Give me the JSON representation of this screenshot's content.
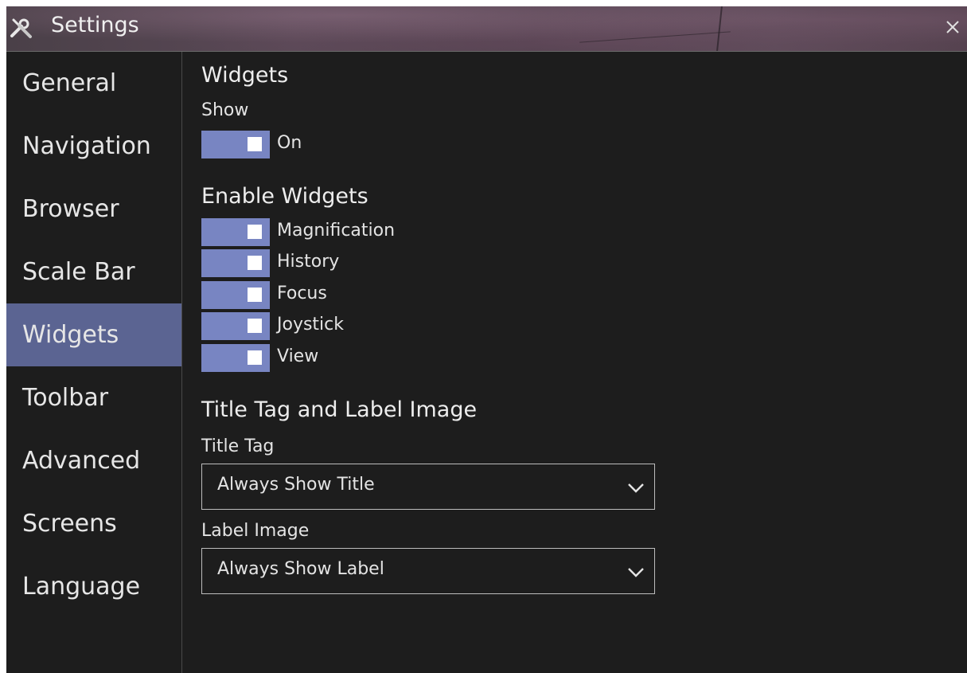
{
  "window": {
    "title": "Settings",
    "title_icon": "tools-icon",
    "close_icon": "close-icon"
  },
  "sidebar": {
    "items": [
      {
        "label": "General"
      },
      {
        "label": "Navigation"
      },
      {
        "label": "Browser"
      },
      {
        "label": "Scale Bar"
      },
      {
        "label": "Widgets",
        "active": true
      },
      {
        "label": "Toolbar"
      },
      {
        "label": "Advanced"
      },
      {
        "label": "Screens"
      },
      {
        "label": "Language"
      }
    ]
  },
  "main": {
    "widgets_heading": "Widgets",
    "show_label": "Show",
    "show_toggle": {
      "label": "On",
      "checked": true
    },
    "enable_heading": "Enable Widgets",
    "enable_toggles": [
      {
        "label": "Magnification",
        "checked": true
      },
      {
        "label": "History",
        "checked": true
      },
      {
        "label": "Focus",
        "checked": true
      },
      {
        "label": "Joystick",
        "checked": true
      },
      {
        "label": "View",
        "checked": true
      }
    ],
    "title_label_heading": "Title Tag and Label Image",
    "title_tag_label": "Title Tag",
    "title_tag_value": "Always Show Title",
    "label_image_label": "Label Image",
    "label_image_value": "Always Show Label"
  },
  "colors": {
    "accent": "#7885c2",
    "active_nav": "#5b6492",
    "background": "#1d1d1d"
  }
}
